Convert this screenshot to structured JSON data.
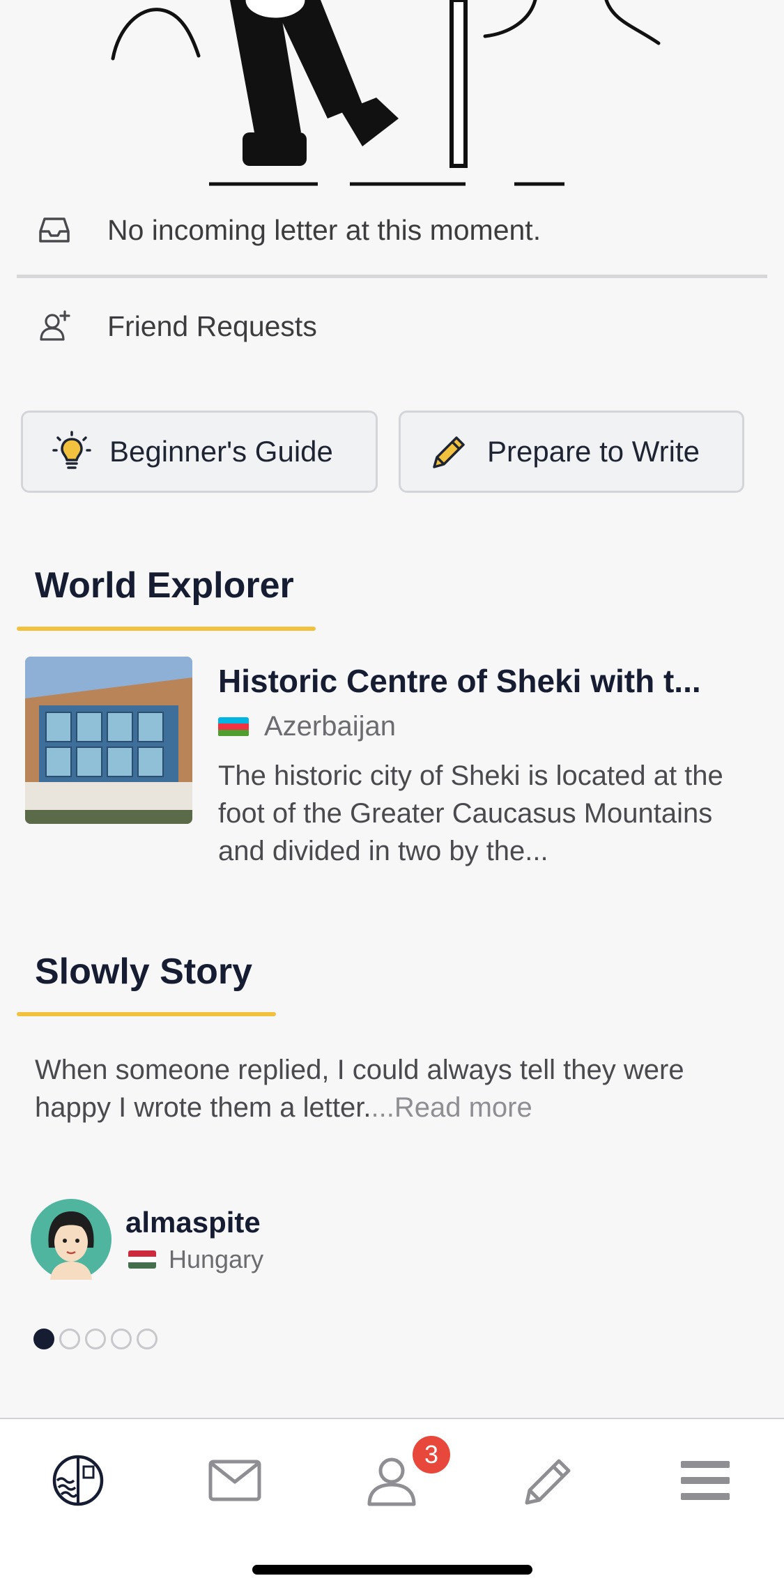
{
  "inbox": {
    "message": "No incoming letter at this moment.",
    "icon": "inbox-tray-icon"
  },
  "friend_requests": {
    "label": "Friend Requests",
    "icon": "add-user-icon"
  },
  "buttons": {
    "beginner_guide": {
      "label": "Beginner's Guide",
      "icon": "lightbulb-icon"
    },
    "prepare_to_write": {
      "label": "Prepare to Write",
      "icon": "pencil-icon"
    }
  },
  "world_explorer": {
    "title": "World Explorer",
    "card": {
      "heading": "Historic Centre of Sheki with t...",
      "country": "Azerbaijan",
      "description": "The historic city of Sheki is located at the foot of the Greater Caucasus Mountains and divided in two by the..."
    }
  },
  "slowly_story": {
    "title": "Slowly Story",
    "text": "When someone replied, I could always tell they were happy I wrote them a letter.",
    "read_more": "...Read more",
    "author": {
      "name": "almaspite",
      "country": "Hungary"
    },
    "pagination": {
      "current": 1,
      "total": 5
    }
  },
  "tabbar": {
    "items": [
      "home-stamp-icon",
      "envelope-icon",
      "friends-icon",
      "pencil-icon",
      "menu-icon"
    ],
    "friends_badge": "3"
  },
  "colors": {
    "accent_underline": "#f2c23f",
    "navy": "#161d33",
    "badge": "#e8483b",
    "background": "#f7f7f8"
  }
}
